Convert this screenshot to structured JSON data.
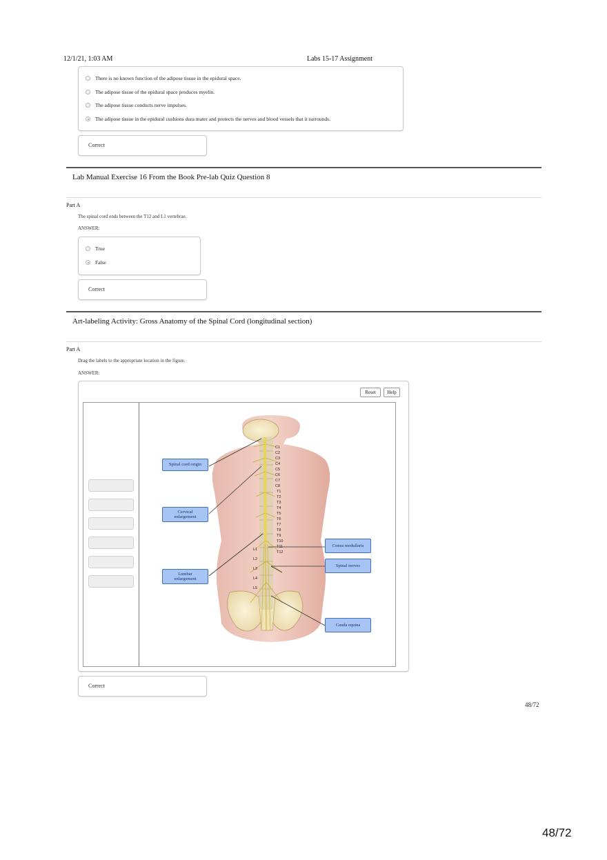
{
  "header": {
    "datetime": "12/1/21, 1:03 AM",
    "title": "Labs 15-17 Assignment"
  },
  "q7": {
    "options": [
      {
        "text": "There is no known function of the adipose tissue in the epidural space.",
        "selected": false
      },
      {
        "text": "The adipose tissue of the epidural space produces myelin.",
        "selected": false
      },
      {
        "text": "The adipose tissue conducts nerve impulses.",
        "selected": false
      },
      {
        "text": "The adipose tissue in the epidural cushions dura mater and protects the nerves and blood vessels that it surrounds.",
        "selected": true
      }
    ],
    "result": "Correct"
  },
  "q8": {
    "title": "Lab Manual Exercise 16 From the Book Pre-lab Quiz Question 8",
    "part": "Part A",
    "prompt": "The spinal cord ends between the T12 and L1 vertebrae.",
    "answer_label": "ANSWER:",
    "options": [
      {
        "text": "True",
        "selected": false
      },
      {
        "text": "False",
        "selected": true
      }
    ],
    "result": "Correct"
  },
  "q9": {
    "title": "Art-labeling Activity: Gross Anatomy of the Spinal Cord (longitudinal section)",
    "part": "Part A",
    "prompt": "Drag the labels to the appropriate location in the figure.",
    "answer_label": "ANSWER:",
    "toolbar": {
      "reset": "Reset",
      "help": "Help"
    },
    "empty_slots": 6,
    "labels": {
      "spinal_cord_origin": "Spinal cord origin",
      "cervical_enlargement": "Cervical\nenlargement",
      "lumbar_enlargement": "Lumbar\nenlargement",
      "conus_medullaris": "Conus medullaris",
      "spinal_nerves": "Spinal nerves",
      "cauda_equina": "Cauda equina"
    },
    "vertebra_marks": {
      "thoracic": [
        "T1",
        "T2",
        "T3",
        "T4",
        "T5",
        "T6",
        "T7",
        "T8",
        "T9",
        "T10",
        "T11",
        "T12"
      ],
      "lumbar": [
        "L1",
        "L2",
        "L3",
        "L4",
        "L5"
      ],
      "cervical": [
        "C1",
        "C2",
        "C3",
        "C4",
        "C5",
        "C6",
        "C7",
        "C8"
      ]
    },
    "result": "Correct"
  },
  "footer": {
    "page_small": "48/72",
    "page_large": "48/72"
  },
  "colors": {
    "label_fill": "#a8c4f5",
    "label_border": "#3f6fb8",
    "rule": "#555555"
  }
}
